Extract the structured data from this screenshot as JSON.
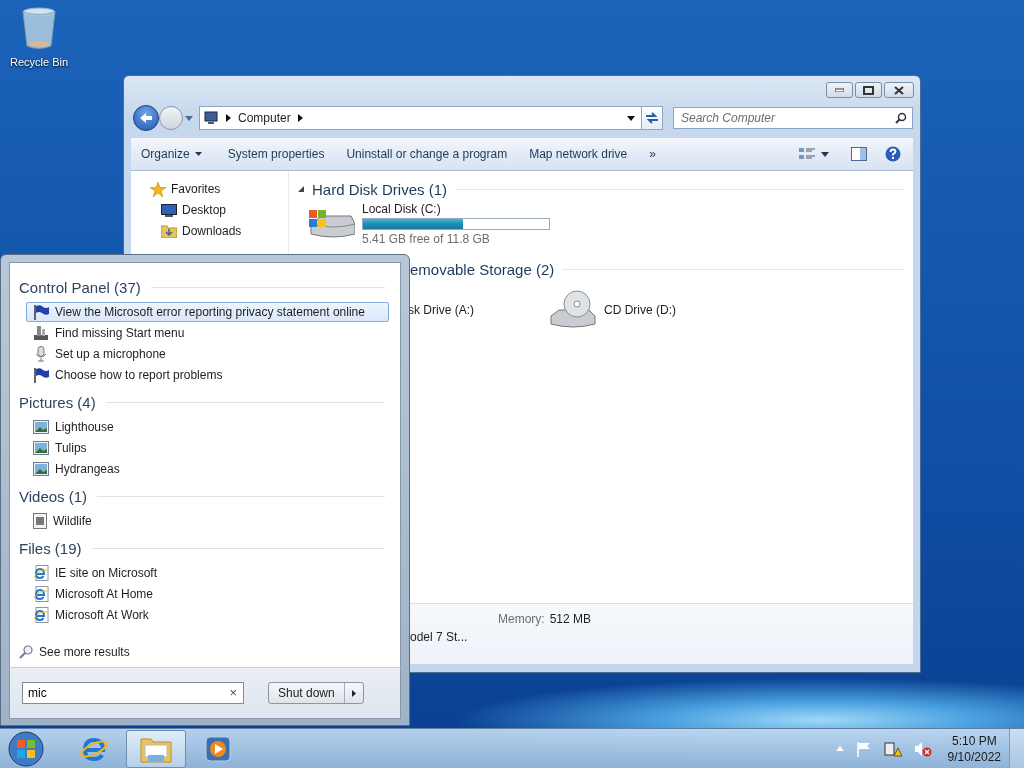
{
  "desktop_icons": [
    {
      "label": "Recycle Bin"
    }
  ],
  "explorer": {
    "address": {
      "path": [
        "Computer"
      ]
    },
    "search": {
      "placeholder": "Search Computer"
    },
    "toolbar": [
      {
        "label": "Organize",
        "dropdown": true
      },
      {
        "label": "System properties",
        "dropdown": false
      },
      {
        "label": "Uninstall or change a program",
        "dropdown": false
      },
      {
        "label": "Map network drive",
        "dropdown": false
      }
    ],
    "overflow": "»",
    "nav": [
      {
        "label": "Favorites",
        "kind": "star"
      },
      {
        "label": "Desktop",
        "kind": "desktop"
      },
      {
        "label": "Downloads",
        "kind": "downloads"
      }
    ],
    "groups": [
      {
        "title": "Hard Disk Drives (1)",
        "kind": "full",
        "drives": [
          {
            "name": "Local Disk (C:)",
            "kind": "hdd",
            "level": 0.54,
            "free": "5.41 GB free of 11.8 GB"
          }
        ]
      },
      {
        "title": "emovable Storage (2)",
        "kind": "clipped",
        "drives": [
          {
            "name": "sk Drive (A:)",
            "kind": "hidden"
          },
          {
            "name": "CD Drive (D:)",
            "kind": "cd"
          }
        ]
      }
    ],
    "details": [
      {
        "label": "Memory:",
        "value": "512 MB"
      },
      {
        "value": "odel 7 St..."
      }
    ]
  },
  "start_menu": {
    "sections": [
      {
        "title": "Control Panel (37)",
        "items": [
          {
            "label": "View the Microsoft error reporting privacy statement online",
            "kind": "flag",
            "selected": true
          },
          {
            "label": "Find missing Start menu",
            "kind": "tool",
            "selected": false
          },
          {
            "label": "Set up a microphone",
            "kind": "mic",
            "selected": false
          },
          {
            "label": "Choose how to report problems",
            "kind": "flag",
            "selected": false
          }
        ]
      },
      {
        "title": "Pictures (4)",
        "items": [
          {
            "label": "Lighthouse",
            "kind": "picture",
            "selected": false
          },
          {
            "label": "Tulips",
            "kind": "picture",
            "selected": false
          },
          {
            "label": "Hydrangeas",
            "kind": "picture",
            "selected": false
          }
        ]
      },
      {
        "title": "Videos (1)",
        "items": [
          {
            "label": "Wildlife",
            "kind": "video",
            "selected": false
          }
        ]
      },
      {
        "title": "Files (19)",
        "items": [
          {
            "label": "IE site on Microsoft",
            "kind": "ie",
            "selected": false
          },
          {
            "label": "Microsoft At Home",
            "kind": "ie",
            "selected": false
          },
          {
            "label": "Microsoft At Work",
            "kind": "ie",
            "selected": false
          }
        ]
      }
    ],
    "see_more": "See more results",
    "search": {
      "value": "mic"
    },
    "clear": "×",
    "shutdown": "Shut down"
  },
  "taskbar": {
    "items": [
      {
        "kind": "ie",
        "selected": false
      },
      {
        "kind": "explorer",
        "selected": true
      },
      {
        "kind": "media",
        "selected": false
      }
    ],
    "clock": {
      "time": "5:10 PM",
      "date": "9/10/2022"
    }
  }
}
